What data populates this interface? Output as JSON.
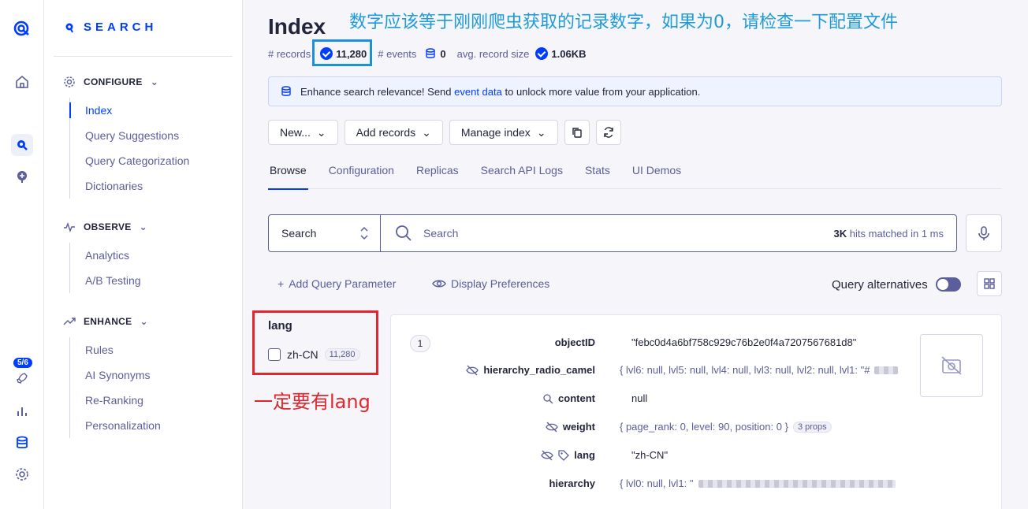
{
  "annotations": {
    "top_note": "数字应该等于刚刚爬虫获取的记录数字，如果为0，请检查一下配置文件",
    "facet_note": "一定要有lang"
  },
  "rail": {
    "progress_badge": "5/6"
  },
  "sidebar": {
    "product": "SEARCH",
    "sections": [
      {
        "label": "CONFIGURE",
        "items": [
          "Index",
          "Query Suggestions",
          "Query Categorization",
          "Dictionaries"
        ]
      },
      {
        "label": "OBSERVE",
        "items": [
          "Analytics",
          "A/B Testing"
        ]
      },
      {
        "label": "ENHANCE",
        "items": [
          "Rules",
          "AI Synonyms",
          "Re-Ranking",
          "Personalization"
        ]
      }
    ]
  },
  "header": {
    "title": "Index",
    "records_label": "# records",
    "records_value": "11,280",
    "events_label": "# events",
    "events_value": "0",
    "size_label": "avg. record size",
    "size_value": "1.06KB"
  },
  "banner": {
    "prefix": "Enhance search relevance! Send",
    "link": "event data",
    "suffix": "to unlock more value from your application."
  },
  "toolbar": {
    "new_label": "New...",
    "add_records_label": "Add records",
    "manage_index_label": "Manage index"
  },
  "tabs": [
    "Browse",
    "Configuration",
    "Replicas",
    "Search API Logs",
    "Stats",
    "UI Demos"
  ],
  "search": {
    "mode": "Search",
    "placeholder": "Search",
    "hits_count": "3K",
    "hits_text": "hits matched in 1 ms"
  },
  "options": {
    "add_param": "Add Query Parameter",
    "display_prefs": "Display Preferences",
    "query_alternatives": "Query alternatives"
  },
  "facet": {
    "title": "lang",
    "item_label": "zh-CN",
    "item_count": "11,280"
  },
  "record": {
    "index": "1",
    "fields": [
      {
        "key": "objectID",
        "value": "\"febc0d4a6bf758c929c76b2e0f4a7207567681d8\""
      },
      {
        "key": "hierarchy_radio_camel",
        "value": "{ lvl6: null, lvl5: null, lvl4: null, lvl3: null, lvl2: null, lvl1: \"#"
      },
      {
        "key": "content",
        "value": "null"
      },
      {
        "key": "weight",
        "value": "{ page_rank: 0, level: 90, position: 0 }",
        "badge": "3 props"
      },
      {
        "key": "lang",
        "value": "\"zh-CN\""
      },
      {
        "key": "hierarchy",
        "value": "{ lvl0: null, lvl1: \""
      }
    ]
  },
  "colors": {
    "accent": "#003dff",
    "annotation_blue": "#1f9bd9",
    "annotation_red": "#e1262d"
  }
}
